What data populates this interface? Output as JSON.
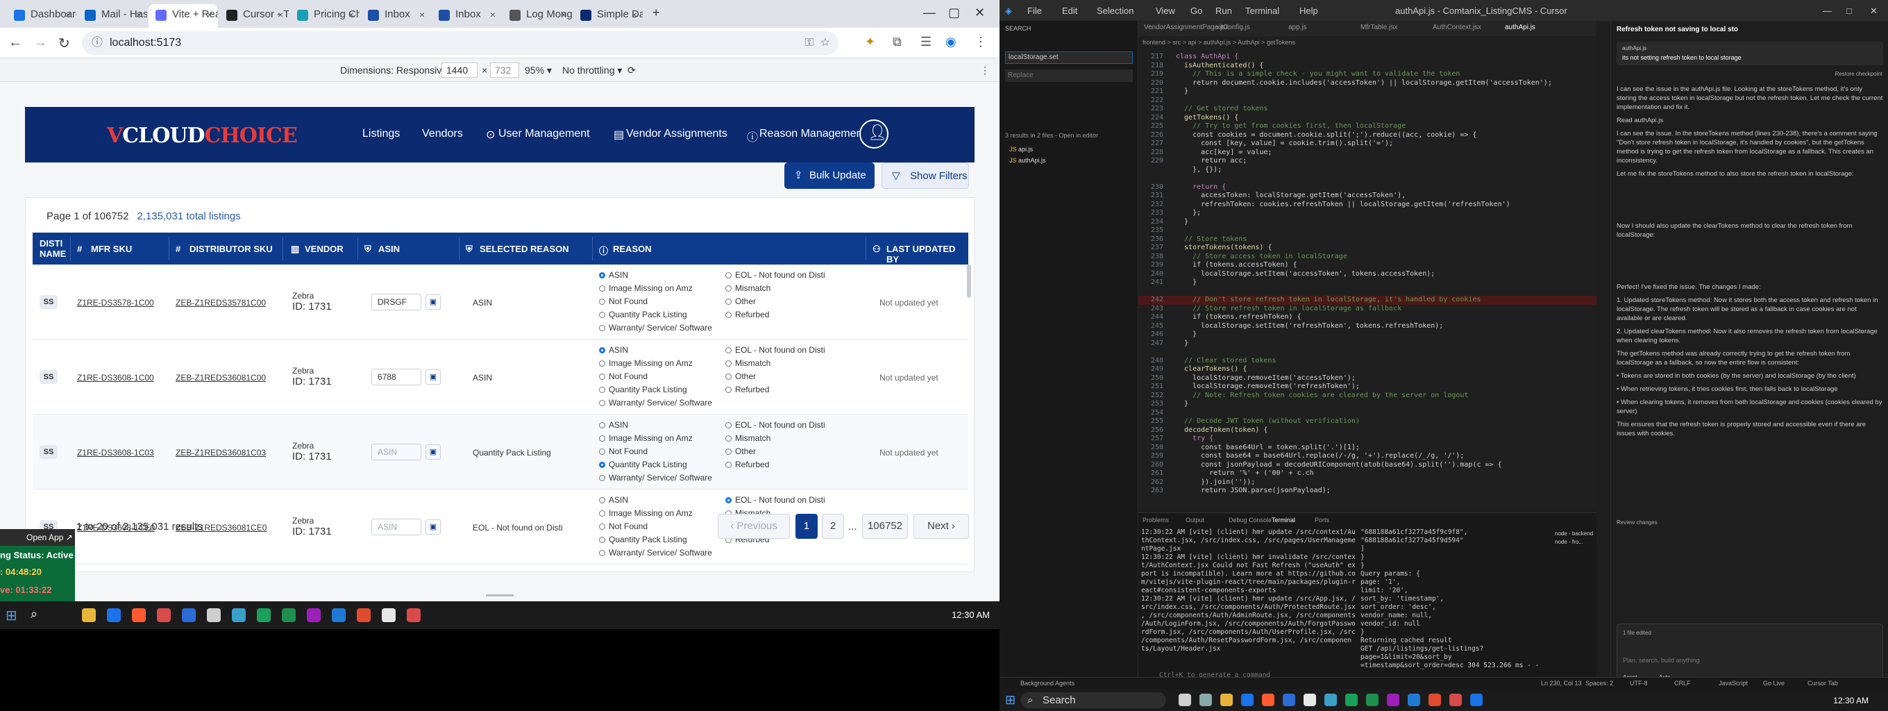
{
  "browser": {
    "tabs": [
      {
        "label": "Dashboard",
        "color": "#1a73e8"
      },
      {
        "label": "Mail - Has",
        "color": "#0a64c9"
      },
      {
        "label": "Vite + Rea",
        "color": "#646cff"
      },
      {
        "label": "Cursor - Th",
        "color": "#222"
      },
      {
        "label": "Pricing Ch",
        "color": "#1a9fb5"
      },
      {
        "label": "Inbox",
        "color": "#1d4fa6"
      },
      {
        "label": "Inbox",
        "color": "#1d4fa6"
      },
      {
        "label": "Log Mongo",
        "color": "#555"
      },
      {
        "label": "Simple Da",
        "color": "#0b2a6f"
      }
    ],
    "url": "localhost:5173",
    "devtools": {
      "dimensions_label": "Dimensions: Responsive ▾",
      "width": "1440",
      "height": "732",
      "zoom": "95% ▾",
      "throttle": "No throttling ▾"
    }
  },
  "app": {
    "logo_v": "V",
    "logo_cloud": "CLOUD",
    "logo_choice": "CHOICE",
    "nav": [
      "Listings",
      "Vendors",
      "User Management",
      "Vendor Assignments",
      "Reason Management"
    ],
    "bulk_update": "Bulk Update",
    "show_filters": "Show Filters",
    "page_info": "Page 1 of 106752",
    "total": "2,135,031 total listings",
    "columns": [
      "DISTI NAME",
      "MFR SKU",
      "DISTRIBUTOR SKU",
      "VENDOR",
      "ASIN",
      "SELECTED REASON",
      "REASON",
      "LAST UPDATED BY"
    ],
    "reason_options_left": [
      "ASIN",
      "Image Missing on Amz",
      "Not Found",
      "Quantity Pack Listing",
      "Warranty/ Service/ Software"
    ],
    "reason_options_right": [
      "EOL - Not found on Disti",
      "Mismatch",
      "Other",
      "Refurbed"
    ],
    "rows": [
      {
        "disti": "SS",
        "mfr": "Z1RE-DS3578-1C00",
        "dsku": "ZEB-Z1REDS35781C00",
        "vendor": "Zebra",
        "vid": "ID: 1731",
        "asin": "DRSGF",
        "asin_ph": false,
        "selected": "ASIN",
        "checked": "ASIN",
        "updated": "Not updated yet"
      },
      {
        "disti": "SS",
        "mfr": "Z1RE-DS3608-1C00",
        "dsku": "ZEB-Z1REDS36081C00",
        "vendor": "Zebra",
        "vid": "ID: 1731",
        "asin": "6788",
        "asin_ph": false,
        "selected": "ASIN",
        "checked": "ASIN",
        "updated": "Not updated yet"
      },
      {
        "disti": "SS",
        "mfr": "Z1RE-DS3608-1C03",
        "dsku": "ZEB-Z1REDS36081C03",
        "vendor": "Zebra",
        "vid": "ID: 1731",
        "asin": "ASIN",
        "asin_ph": true,
        "selected": "Quantity Pack Listing",
        "checked": "Quantity Pack Listing",
        "updated": "Not updated yet"
      },
      {
        "disti": "SS",
        "mfr": "Z1RE-DS3608-1CE0",
        "dsku": "ZEB-Z1REDS36081CE0",
        "vendor": "Zebra",
        "vid": "ID: 1731",
        "asin": "ASIN",
        "asin_ph": true,
        "selected": "EOL - Not found on Disti",
        "checked": "EOL - Not found on Disti",
        "updated": ""
      }
    ],
    "results": "1 to 20 of 2,135,031 results",
    "pager": {
      "prev": "‹ Previous",
      "p1": "1",
      "p2": "2",
      "ellipsis": "...",
      "last": "106752",
      "next": "Next ›"
    },
    "open_app": "Open App ↗",
    "status_active": "ng Status: Active",
    "time1": ": 04:48:20",
    "time2": "ve: 01:33:22"
  },
  "taskbar_left": {
    "clock": "12:30 AM"
  },
  "vscode": {
    "menu": [
      "File",
      "Edit",
      "Selection",
      "View",
      "Go",
      "Run",
      "Terminal",
      "Help"
    ],
    "title": "authApi.js - Comtanix_ListingCMS - Cursor",
    "sidebar_title": "SEARCH",
    "search_term": "localStorage.set",
    "replace_ph": "Replace",
    "results_summary": "3 results in 2 files - Open in editor",
    "editor_tabs": [
      "VendorAssignmentPage.jsx",
      "vitConfig.js",
      "app.js",
      "MfrTable.jsx",
      "AuthContext.jsx",
      "authApi.js"
    ],
    "breadcrumb": "frontend > src > api > authApi.js > AuthApi > getTokens",
    "code": [
      {
        "n": "217",
        "t": "class AuthApi {",
        "c": "kw"
      },
      {
        "n": "218",
        "t": "  isAuthenticated() {",
        "c": "fn"
      },
      {
        "n": "219",
        "t": "    // This is a simple check - you might want to validate the token",
        "c": "cm"
      },
      {
        "n": "220",
        "t": "    return document.cookie.includes('accessToken') || localStorage.getItem('accessToken');",
        "c": ""
      },
      {
        "n": "221",
        "t": "  }",
        "c": ""
      },
      {
        "n": "222",
        "t": "",
        "c": ""
      },
      {
        "n": "223",
        "t": "  // Get stored tokens",
        "c": "cm"
      },
      {
        "n": "224",
        "t": "  getTokens() {",
        "c": "fn"
      },
      {
        "n": "225",
        "t": "    // Try to get from cookies first, then localStorage",
        "c": "cm"
      },
      {
        "n": "226",
        "t": "    const cookies = document.cookie.split(';').reduce((acc, cookie) => {",
        "c": ""
      },
      {
        "n": "227",
        "t": "      const [key, value] = cookie.trim().split('=');",
        "c": ""
      },
      {
        "n": "228",
        "t": "      acc[key] = value;",
        "c": ""
      },
      {
        "n": "229",
        "t": "      return acc;",
        "c": ""
      },
      {
        "n": "",
        "t": "    }, {});",
        "c": ""
      },
      {
        "n": "",
        "t": "",
        "c": ""
      },
      {
        "n": "230",
        "t": "    return {",
        "c": "kw"
      },
      {
        "n": "231",
        "t": "      accessToken: localStorage.getItem('accessToken'),",
        "c": ""
      },
      {
        "n": "232",
        "t": "      refreshToken: cookies.refreshToken || localStorage.getItem('refreshToken')",
        "c": ""
      },
      {
        "n": "233",
        "t": "    };",
        "c": ""
      },
      {
        "n": "234",
        "t": "  }",
        "c": ""
      },
      {
        "n": "235",
        "t": "",
        "c": ""
      },
      {
        "n": "236",
        "t": "  // Store tokens",
        "c": "cm"
      },
      {
        "n": "237",
        "t": "  storeTokens(tokens) {",
        "c": "fn"
      },
      {
        "n": "238",
        "t": "    // Store access token in localStorage",
        "c": "cm"
      },
      {
        "n": "239",
        "t": "    if (tokens.accessToken) {",
        "c": ""
      },
      {
        "n": "240",
        "t": "      localStorage.setItem('accessToken', tokens.accessToken);",
        "c": ""
      },
      {
        "n": "241",
        "t": "    }",
        "c": ""
      },
      {
        "n": "",
        "t": "",
        "c": ""
      },
      {
        "n": "242",
        "t": "    // Don't store refresh token in localStorage, it's handled by cookies",
        "c": "red"
      },
      {
        "n": "243",
        "t": "    // Store refresh token in localStorage as fallback",
        "c": "cm"
      },
      {
        "n": "244",
        "t": "    if (tokens.refreshToken) {",
        "c": ""
      },
      {
        "n": "245",
        "t": "      localStorage.setItem('refreshToken', tokens.refreshToken);",
        "c": ""
      },
      {
        "n": "246",
        "t": "    }",
        "c": ""
      },
      {
        "n": "247",
        "t": "  }",
        "c": ""
      },
      {
        "n": "",
        "t": "",
        "c": ""
      },
      {
        "n": "248",
        "t": "  // Clear stored tokens",
        "c": "cm"
      },
      {
        "n": "249",
        "t": "  clearTokens() {",
        "c": "fn"
      },
      {
        "n": "250",
        "t": "    localStorage.removeItem('accessToken');",
        "c": ""
      },
      {
        "n": "251",
        "t": "    localStorage.removeItem('refreshToken');",
        "c": ""
      },
      {
        "n": "252",
        "t": "    // Note: Refresh token cookies are cleared by the server on logout",
        "c": "cm"
      },
      {
        "n": "253",
        "t": "  }",
        "c": ""
      },
      {
        "n": "254",
        "t": "",
        "c": ""
      },
      {
        "n": "255",
        "t": "  // Decode JWT token (without verification)",
        "c": "cm"
      },
      {
        "n": "256",
        "t": "  decodeToken(token) {",
        "c": "fn"
      },
      {
        "n": "257",
        "t": "    try {",
        "c": "kw"
      },
      {
        "n": "258",
        "t": "      const base64Url = token.split('.')[1];",
        "c": ""
      },
      {
        "n": "259",
        "t": "      const base64 = base64Url.replace(/-/g, '+').replace(/_/g, '/');",
        "c": ""
      },
      {
        "n": "260",
        "t": "      const jsonPayload = decodeURIComponent(atob(base64).split('').map(c => {",
        "c": ""
      },
      {
        "n": "261",
        "t": "        return '%' + ('00' + c.ch",
        "c": ""
      },
      {
        "n": "262",
        "t": "      }).join(''));",
        "c": ""
      },
      {
        "n": "263",
        "t": "      return JSON.parse(jsonPayload);",
        "c": ""
      }
    ],
    "panel_tabs": [
      "Problems",
      "Output",
      "Debug Console",
      "Terminal",
      "Ports"
    ],
    "terminal_left": [
      "12:30:22 AM [vite] (client) hmr update /src/context/Au",
      "thContext.jsx, /src/index.css, /src/pages/UserManageme",
      "ntPage.jsx",
      "12:30:22 AM [vite] (client) hmr invalidate /src/contex",
      "t/AuthContext.jsx Could not Fast Refresh (\"useAuth\" ex",
      "port is incompatible). Learn more at https://github.co",
      "m/vitejs/vite-plugin-react/tree/main/packages/plugin-r",
      "eact#consistent-components-exports",
      "12:30:22 AM [vite] (client) hmr update /src/App.jsx, /",
      "src/index.css, /src/components/Auth/ProtectedRoute.jsx",
      ", /src/components/Auth/AdminRoute.jsx, /src/components",
      "/Auth/LoginForm.jsx, /src/components/Auth/ForgotPasswo",
      "rdForm.jsx, /src/components/Auth/UserProfile.jsx, /src",
      "/components/Auth/ResetPasswordForm.jsx, /src/componen",
      "ts/Layout/Header.jsx"
    ],
    "terminal_right": [
      "\"688188a61cf3277a45f9c9f8\",",
      "\"688188a61cf3277a45f9d594\"",
      "    ]",
      "  }",
      "}",
      "Query params: {",
      "  page: '1',",
      "  limit: '20',",
      "  sort_by: 'timestamp',",
      "  sort_order: 'desc',",
      "  vendor_name: null,",
      "  vendor_id: null",
      "}",
      "Returning cached result",
      "GET /api/listings/get-listings?page=1&limit=20&sort_by",
      "=timestamp&sort_order=desc 304 523.266 ms - -"
    ],
    "terminal_hint": "Ctrl+K to generate a command",
    "term_sessions": [
      "node - backend",
      "node - fro..."
    ],
    "chat_title": "Refresh token not saving to local sto",
    "chat_user_file": "authApi.js",
    "chat_user_msg": "its not setting refresh token to local storage",
    "restore_checkpoint": "Restore checkpoint",
    "chat_paras": [
      "I can see the issue in the authApi.js file. Looking at the storeTokens method, it's only storing the access token in localStorage but not the refresh token. Let me check the current implementation and fix it.",
      "Read authApi.js",
      "I can see the issue. In the storeTokens method (lines 230-238), there's a comment saying \"Don't store refresh token in localStorage, it's handled by cookies\", but the getTokens method is trying to get the refresh token from localStorage as a fallback. This creates an inconsistency.",
      "Let me fix the storeTokens method to also store the refresh token in localStorage:",
      "Now I should also update the clearTokens method to clear the refresh token from localStorage:",
      "Perfect! I've fixed the issue. The changes I made:",
      "1. Updated storeTokens method: Now it stores both the access token and refresh token in localStorage. The refresh token will be stored as a fallback in case cookies are not available or are cleared.",
      "2. Updated clearTokens method: Now it also removes the refresh token from localStorage when clearing tokens.",
      "The getTokens method was already correctly trying to get the refresh token from localStorage as a fallback, so now the entire flow is consistent:",
      "• Tokens are stored in both cookies (by the server) and localStorage (by the client)",
      "• When retrieving tokens, it tries cookies first, then falls back to localStorage",
      "• When clearing tokens, it removes from both localStorage and cookies (cookies cleared by server)",
      "This ensures that the refresh token is properly stored and accessible even if there are issues with cookies."
    ],
    "review_changes": "Review changes",
    "file_edited": "1 file edited",
    "chat_input_ph": "Plan, search, build anything",
    "agent_label": "Agent",
    "model_label": "Auto",
    "status_left": "Background Agents",
    "status_items": [
      "Ln 230, Col 13",
      "Spaces: 2",
      "UTF-8",
      "CRLF",
      "JavaScript",
      "Go Live",
      "Cursor Tab"
    ],
    "search_placeholder": "Search",
    "clock": "12:30 AM"
  }
}
